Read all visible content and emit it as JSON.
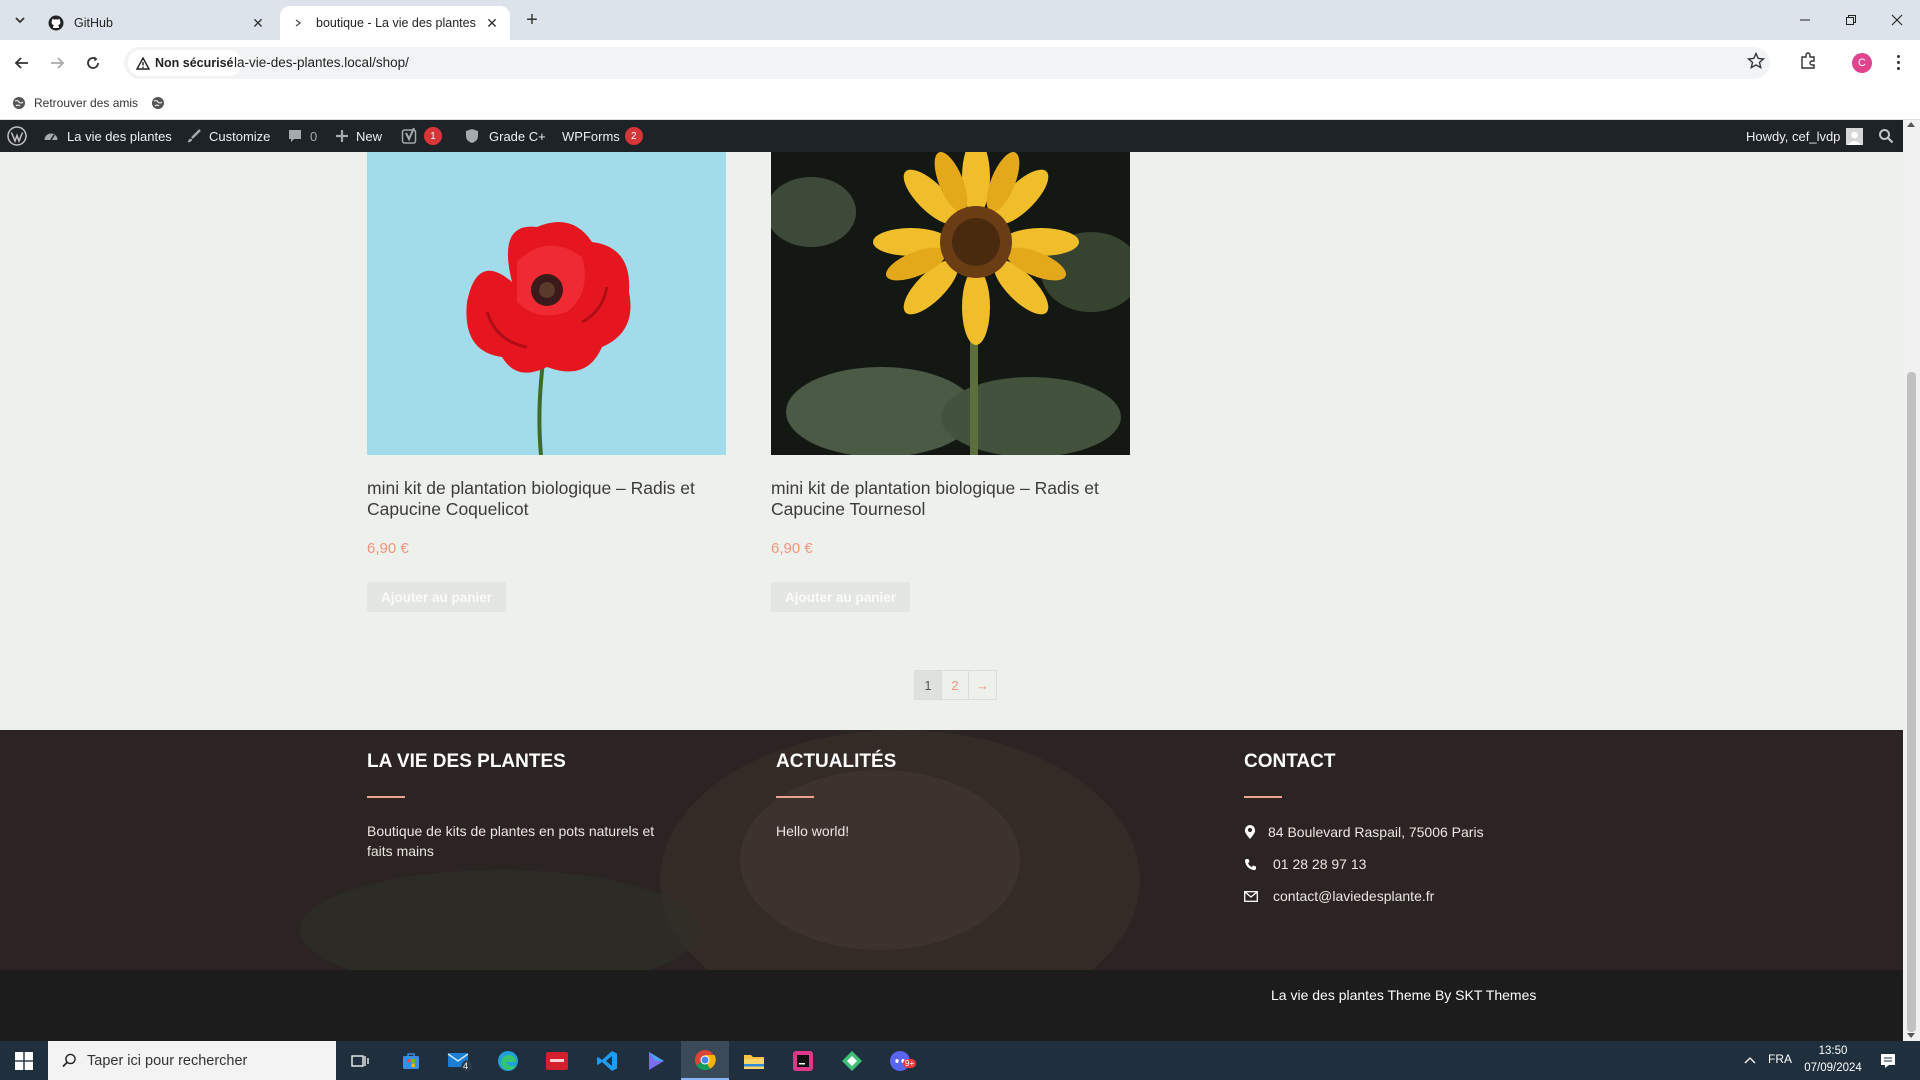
{
  "browser": {
    "tabs": [
      {
        "label": "GitHub",
        "icon": "github-icon",
        "active": false
      },
      {
        "label": "boutique - La vie des plantes",
        "icon": "site-favicon",
        "active": true
      }
    ],
    "security_label": "Non sécurisé",
    "url": "la-vie-des-plantes.local/shop/",
    "profile_initial": "C",
    "bookmarks": [
      {
        "label": "Retrouver des amis",
        "icon": "globe-icon"
      },
      {
        "label": "",
        "icon": "globe-icon"
      }
    ]
  },
  "admin_bar": {
    "site_name": "La vie des plantes",
    "customize": "Customize",
    "comments_count": "0",
    "new_label": "New",
    "yoast_count": "1",
    "grade_label": "Grade C+",
    "wpforms_label": "WPForms",
    "wpforms_count": "2",
    "howdy": "Howdy, cef_lvdp"
  },
  "products": [
    {
      "title": "mini kit de plantation biologique – Radis et Capucine Coquelicot",
      "price": "6,90 €",
      "button": "Ajouter au panier",
      "image": "red-poppy-photo"
    },
    {
      "title": "mini kit de plantation biologique – Radis et Capucine Tournesol",
      "price": "6,90 €",
      "button": "Ajouter au panier",
      "image": "sunflower-photo"
    }
  ],
  "pagination": {
    "pages": [
      "1",
      "2"
    ],
    "next": "→",
    "current": "1"
  },
  "footer": {
    "col1": {
      "heading": "LA VIE DES PLANTES",
      "text": "Boutique de kits de plantes en pots naturels et faits mains"
    },
    "col2": {
      "heading": "ACTUALITÉS",
      "link": "Hello world!"
    },
    "col3": {
      "heading": "CONTACT",
      "address": "84 Boulevard Raspail, 75006 Paris",
      "phone": "01 28 28 97 13",
      "email": "contact@laviedesplante.fr"
    },
    "credit": "La vie des plantes Theme By SKT Themes"
  },
  "taskbar": {
    "search_placeholder": "Taper ici pour rechercher",
    "mail_badge": "4",
    "discord_badge": "9+",
    "language": "FRA",
    "time": "13:50",
    "date": "07/09/2024"
  },
  "colors": {
    "accent": "#f0957b",
    "admin_bar": "#1d2327",
    "footer": "#2b2422"
  }
}
